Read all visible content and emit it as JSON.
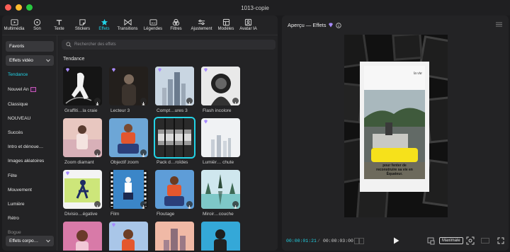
{
  "window": {
    "title": "1013-copie"
  },
  "colors": {
    "accent": "#22d3e6",
    "gem": "#a88bff"
  },
  "toolbar": [
    {
      "label": "Multimédia",
      "icon": "media-icon"
    },
    {
      "label": "Son",
      "icon": "music-disc-icon"
    },
    {
      "label": "Texte",
      "icon": "text-icon"
    },
    {
      "label": "Stickers",
      "icon": "sticker-icon"
    },
    {
      "label": "Effets",
      "icon": "effects-star-icon",
      "active": true
    },
    {
      "label": "Transitions",
      "icon": "transition-icon"
    },
    {
      "label": "Légendes",
      "icon": "captions-icon"
    },
    {
      "label": "Filtres",
      "icon": "filter-icon"
    },
    {
      "label": "Ajustement",
      "icon": "adjust-sliders-icon"
    },
    {
      "label": "Modèles",
      "icon": "template-icon"
    },
    {
      "label": "Avatar IA",
      "icon": "avatar-icon"
    }
  ],
  "sidebar": {
    "favorites": "Favoris",
    "category": "Effets vidéo",
    "items": [
      "Tendance",
      "Nouvel An",
      "Classique",
      "NOUVEAU",
      "Succès",
      "Intro et dénoue…",
      "Images aléatoires",
      "Fête",
      "Mouvement",
      "Lumière",
      "Rétro",
      "Bogue"
    ],
    "bottom": "Effets corpo…"
  },
  "search": {
    "placeholder": "Rechercher des effets"
  },
  "section_title": "Tendance",
  "effects": [
    {
      "label": "Graffiti…la craie",
      "gem": true,
      "download": true
    },
    {
      "label": "Lecteur 3",
      "gem": true,
      "download": true
    },
    {
      "label": "Compt…ures 3",
      "gem": true,
      "download": true
    },
    {
      "label": "Flash incolore",
      "gem": true,
      "download": true
    },
    {
      "label": "Zoom diamant",
      "gem": false,
      "download": true
    },
    {
      "label": "Objectif zoom",
      "gem": false,
      "download": true
    },
    {
      "label": "Pack d…roïdes",
      "gem": false,
      "download": false
    },
    {
      "label": "Lumièr… chute",
      "gem": true,
      "download": false
    },
    {
      "label": "Divisio…égative",
      "gem": true,
      "download": true
    },
    {
      "label": "Film",
      "gem": false,
      "download": true
    },
    {
      "label": "Floutage",
      "gem": false,
      "download": true
    },
    {
      "label": "Miroir…couche",
      "gem": false,
      "download": true
    },
    {
      "label": "",
      "gem": false,
      "download": false
    },
    {
      "label": "",
      "gem": true,
      "download": false
    },
    {
      "label": "",
      "gem": false,
      "download": false
    },
    {
      "label": "",
      "gem": false,
      "download": false
    }
  ],
  "preview": {
    "title": "Aperçu — Effets",
    "caption": "pour fenter de reconstruire sa vie en Équateur.",
    "current_time": "00:00:01:21",
    "total_time": "00:00:03:00",
    "max_label": "Maximale"
  }
}
